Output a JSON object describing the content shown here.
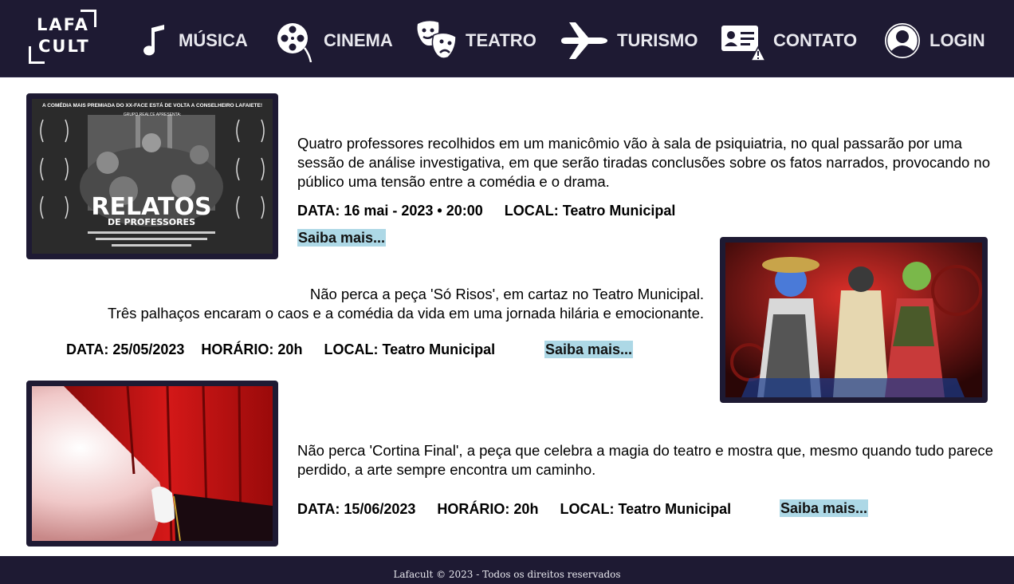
{
  "brand": {
    "logo_line1": "LAFA",
    "logo_line2": "CULT"
  },
  "nav": [
    {
      "label": "MÚSICA",
      "icon": "music-note-icon"
    },
    {
      "label": "CINEMA",
      "icon": "film-reel-icon"
    },
    {
      "label": "TEATRO",
      "icon": "theater-masks-icon"
    },
    {
      "label": "TURISMO",
      "icon": "airplane-icon"
    },
    {
      "label": "CONTATO",
      "icon": "contact-card-icon"
    },
    {
      "label": "LOGIN",
      "icon": "user-icon"
    }
  ],
  "events": [
    {
      "description": "Quatro professores recolhidos em um manicômio vão à sala de psiquiatria, no qual passarão por uma sessão de análise investigativa, em que serão tiradas conclusões sobre os fatos narrados, provocando no público uma tensão entre a comédia e o drama.",
      "date": "DATA: 16 mai - 2023 • 20:00",
      "location": "LOCAL: Teatro Municipal",
      "more": "Saiba mais...",
      "poster": {
        "headline": "A COMÉDIA MAIS PREMIADA DO XX-FACE ESTÁ DE VOLTA A CONSELHEIRO LAFAIETE!",
        "presents": "GRUPO REALCE APRESENTA:",
        "title": "RELATOS",
        "subtitle": "DE PROFESSORES"
      }
    },
    {
      "description_line1": "Não perca a peça 'Só Risos', em cartaz no Teatro Municipal.",
      "description_line2": "Três palhaços encaram o caos e a comédia da vida em uma jornada hilária e emocionante.",
      "date": "DATA: 25/05/2023",
      "time": "HORÁRIO: 20h",
      "location": "LOCAL: Teatro Municipal",
      "more": "Saiba mais..."
    },
    {
      "description": "Não perca 'Cortina Final', a peça que celebra a magia do teatro e mostra que, mesmo quando tudo parece perdido, a arte sempre encontra um caminho.",
      "date": "DATA: 15/06/2023",
      "time": "HORÁRIO: 20h",
      "location": "LOCAL: Teatro Municipal",
      "more": "Saiba mais..."
    }
  ],
  "footer": {
    "text": "Lafacult © 2023 - Todos os direitos reservados"
  },
  "colors": {
    "header_bg": "#1e1a33",
    "link_bg": "#add8e6",
    "text": "#000000"
  }
}
